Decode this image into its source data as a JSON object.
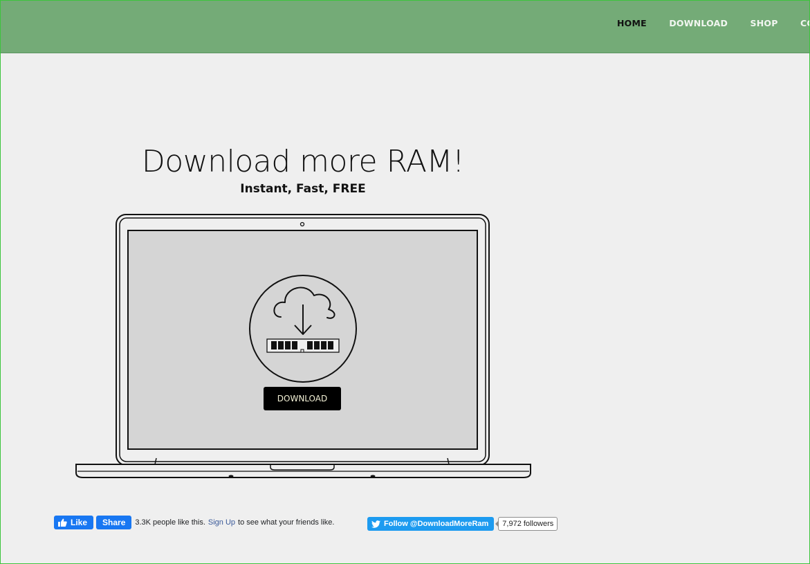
{
  "nav": {
    "items": [
      {
        "label": "HOME",
        "active": true
      },
      {
        "label": "DOWNLOAD",
        "active": false
      },
      {
        "label": "SHOP",
        "active": false
      },
      {
        "label": "CONTACT",
        "active": false
      }
    ]
  },
  "hero": {
    "title": "Download more RAM!",
    "subtitle": "Instant, Fast, FREE",
    "button_label": "DOWNLOAD"
  },
  "facebook": {
    "like_label": "Like",
    "share_label": "Share",
    "count_text": "3.3K people like this.",
    "signup_link": "Sign Up",
    "after_text": "to see what your friends like."
  },
  "twitter": {
    "follow_label": "Follow @DownloadMoreRam",
    "followers": "7,972 followers"
  },
  "colors": {
    "header": "#74ab77",
    "background": "#efefef",
    "facebook": "#1877f2",
    "twitter": "#1d9bf0"
  },
  "icons": [
    "thumbs-up-icon",
    "twitter-bird-icon",
    "cloud-download-icon",
    "ram-stick-icon",
    "laptop-illustration"
  ]
}
